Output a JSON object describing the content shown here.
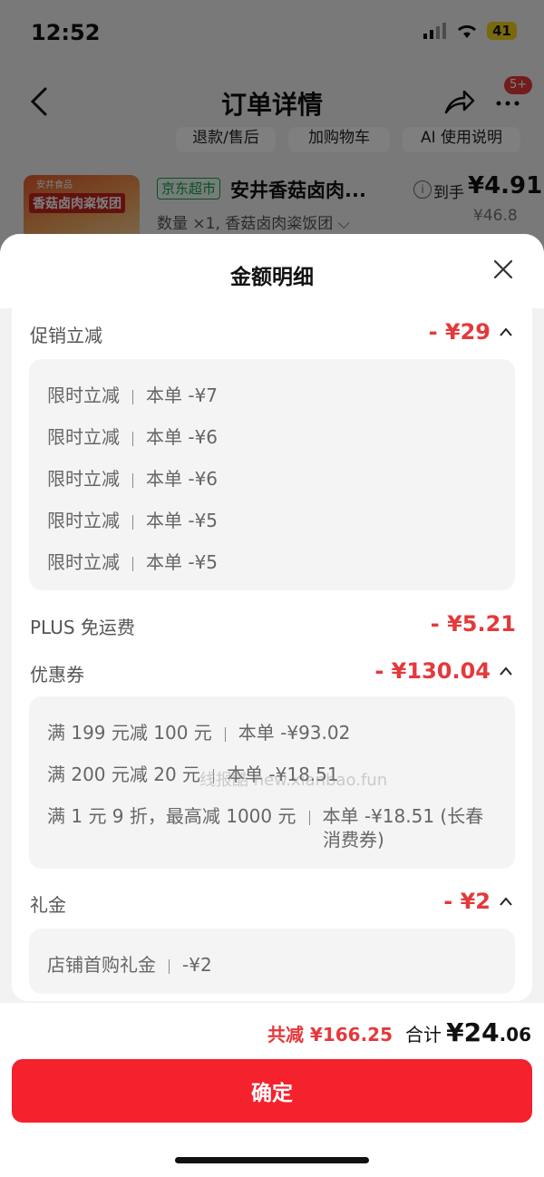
{
  "status_bar": {
    "time": "12:52",
    "battery": "41"
  },
  "nav": {
    "title": "订单详情",
    "more_badge": "5+"
  },
  "pills": [
    "退款/售后",
    "加购物车",
    "AI 使用说明"
  ],
  "product": {
    "image_brand": "安井食品",
    "image_label": "香菇卤肉粢饭团",
    "store_tag": "京东超市",
    "name": "安井香菇卤肉...",
    "spec": "数量 ×1, 香菇卤肉粢饭团",
    "price_label": "到手",
    "price": "¥4.91",
    "original_price": "¥46.8"
  },
  "sheet": {
    "title": "金额明细",
    "sections": {
      "promo": {
        "title": "促销立减",
        "amount": "- ¥29",
        "lines": [
          {
            "left": "限时立减",
            "right": "本单 -¥7"
          },
          {
            "left": "限时立减",
            "right": "本单 -¥6"
          },
          {
            "left": "限时立减",
            "right": "本单 -¥6"
          },
          {
            "left": "限时立减",
            "right": "本单 -¥5"
          },
          {
            "left": "限时立减",
            "right": "本单 -¥5"
          }
        ]
      },
      "shipping": {
        "title": "PLUS 免运费",
        "amount": "- ¥5.21"
      },
      "coupon": {
        "title": "优惠券",
        "amount": "- ¥130.04",
        "lines": [
          {
            "left": "满 199 元减 100 元",
            "right": "本单 -¥93.02"
          },
          {
            "left": "满 200 元减 20 元",
            "right": "本单 -¥18.51"
          },
          {
            "left": "满 1 元 9 折，最高减 1000 元",
            "right": "本单 -¥18.51 (长春",
            "right2": "消费券)"
          }
        ]
      },
      "gift": {
        "title": "礼金",
        "amount": "- ¥2",
        "lines": [
          {
            "left": "店铺首购礼金",
            "right": "-¥2"
          }
        ]
      }
    },
    "watermark": "线报酷 new.xianbao.fun"
  },
  "footer": {
    "total_saved": "共减 ¥166.25",
    "sum_label": "合计",
    "sum_int": "¥24",
    "sum_dec": ".06",
    "confirm": "确定"
  },
  "colors": {
    "accent_red": "#e4393c",
    "button_red": "#f5212d",
    "store_green": "#1a9a4a"
  }
}
